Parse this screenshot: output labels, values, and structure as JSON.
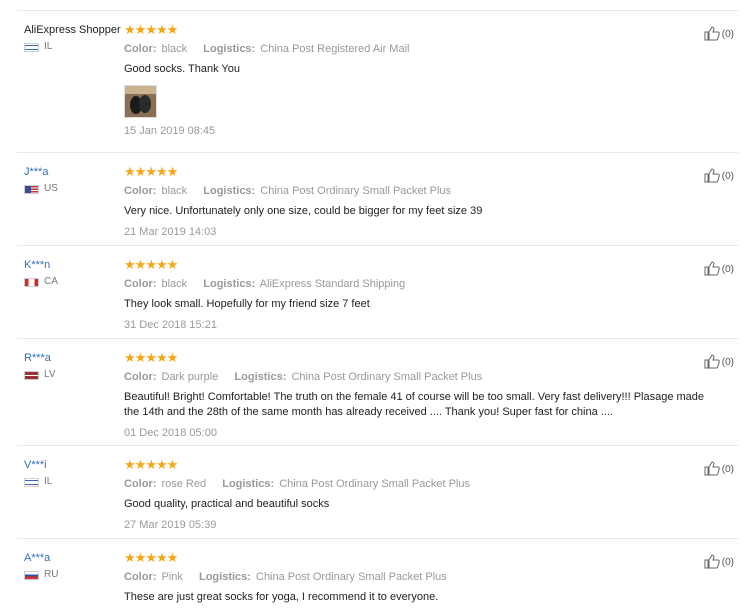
{
  "labels": {
    "color": "Color:",
    "logistics": "Logistics:"
  },
  "reviews": [
    {
      "user": "AliExpress Shopper",
      "country": "IL",
      "color": "black",
      "logistics": "China Post Registered Air Mail",
      "text": "Good socks. Thank You",
      "date": "15 Jan 2019 08:45",
      "helpful": "(0)",
      "has_photo": true
    },
    {
      "user": "J***a",
      "country": "US",
      "color": "black",
      "logistics": "China Post Ordinary Small Packet Plus",
      "text": "Very nice. Unfortunately only one size, could be bigger for my feet size 39",
      "date": "21 Mar 2019 14:03",
      "helpful": "(0)"
    },
    {
      "user": "K***n",
      "country": "CA",
      "color": "black",
      "logistics": "AliExpress Standard Shipping",
      "text": "They look small. Hopefully for my friend size 7 feet",
      "date": "31 Dec 2018 15:21",
      "helpful": "(0)"
    },
    {
      "user": "R***a",
      "country": "LV",
      "color": "Dark purple",
      "logistics": "China Post Ordinary Small Packet Plus",
      "text": "Beautiful! Bright! Comfortable! The truth on the female 41 of course will be too small. Very fast delivery!!! Plasage made the 14th and the 28th of the same month has already received .... Thank you! Super fast for china ....",
      "date": "01 Dec 2018 05:00",
      "helpful": "(0)"
    },
    {
      "user": "V***i",
      "country": "IL",
      "color": "rose Red",
      "logistics": "China Post Ordinary Small Packet Plus",
      "text": "Good quality, practical and beautiful socks",
      "date": "27 Mar 2019 05:39",
      "helpful": "(0)"
    },
    {
      "user": "A***a",
      "country": "RU",
      "color": "Pink",
      "logistics": "China Post Ordinary Small Packet Plus",
      "text": "These are just great socks for yoga, I recommend it to everyone.",
      "date": "",
      "helpful": "(0)"
    }
  ],
  "rating": 5,
  "colors": {
    "star": "#f6a514",
    "link": "#2f6fb6"
  }
}
